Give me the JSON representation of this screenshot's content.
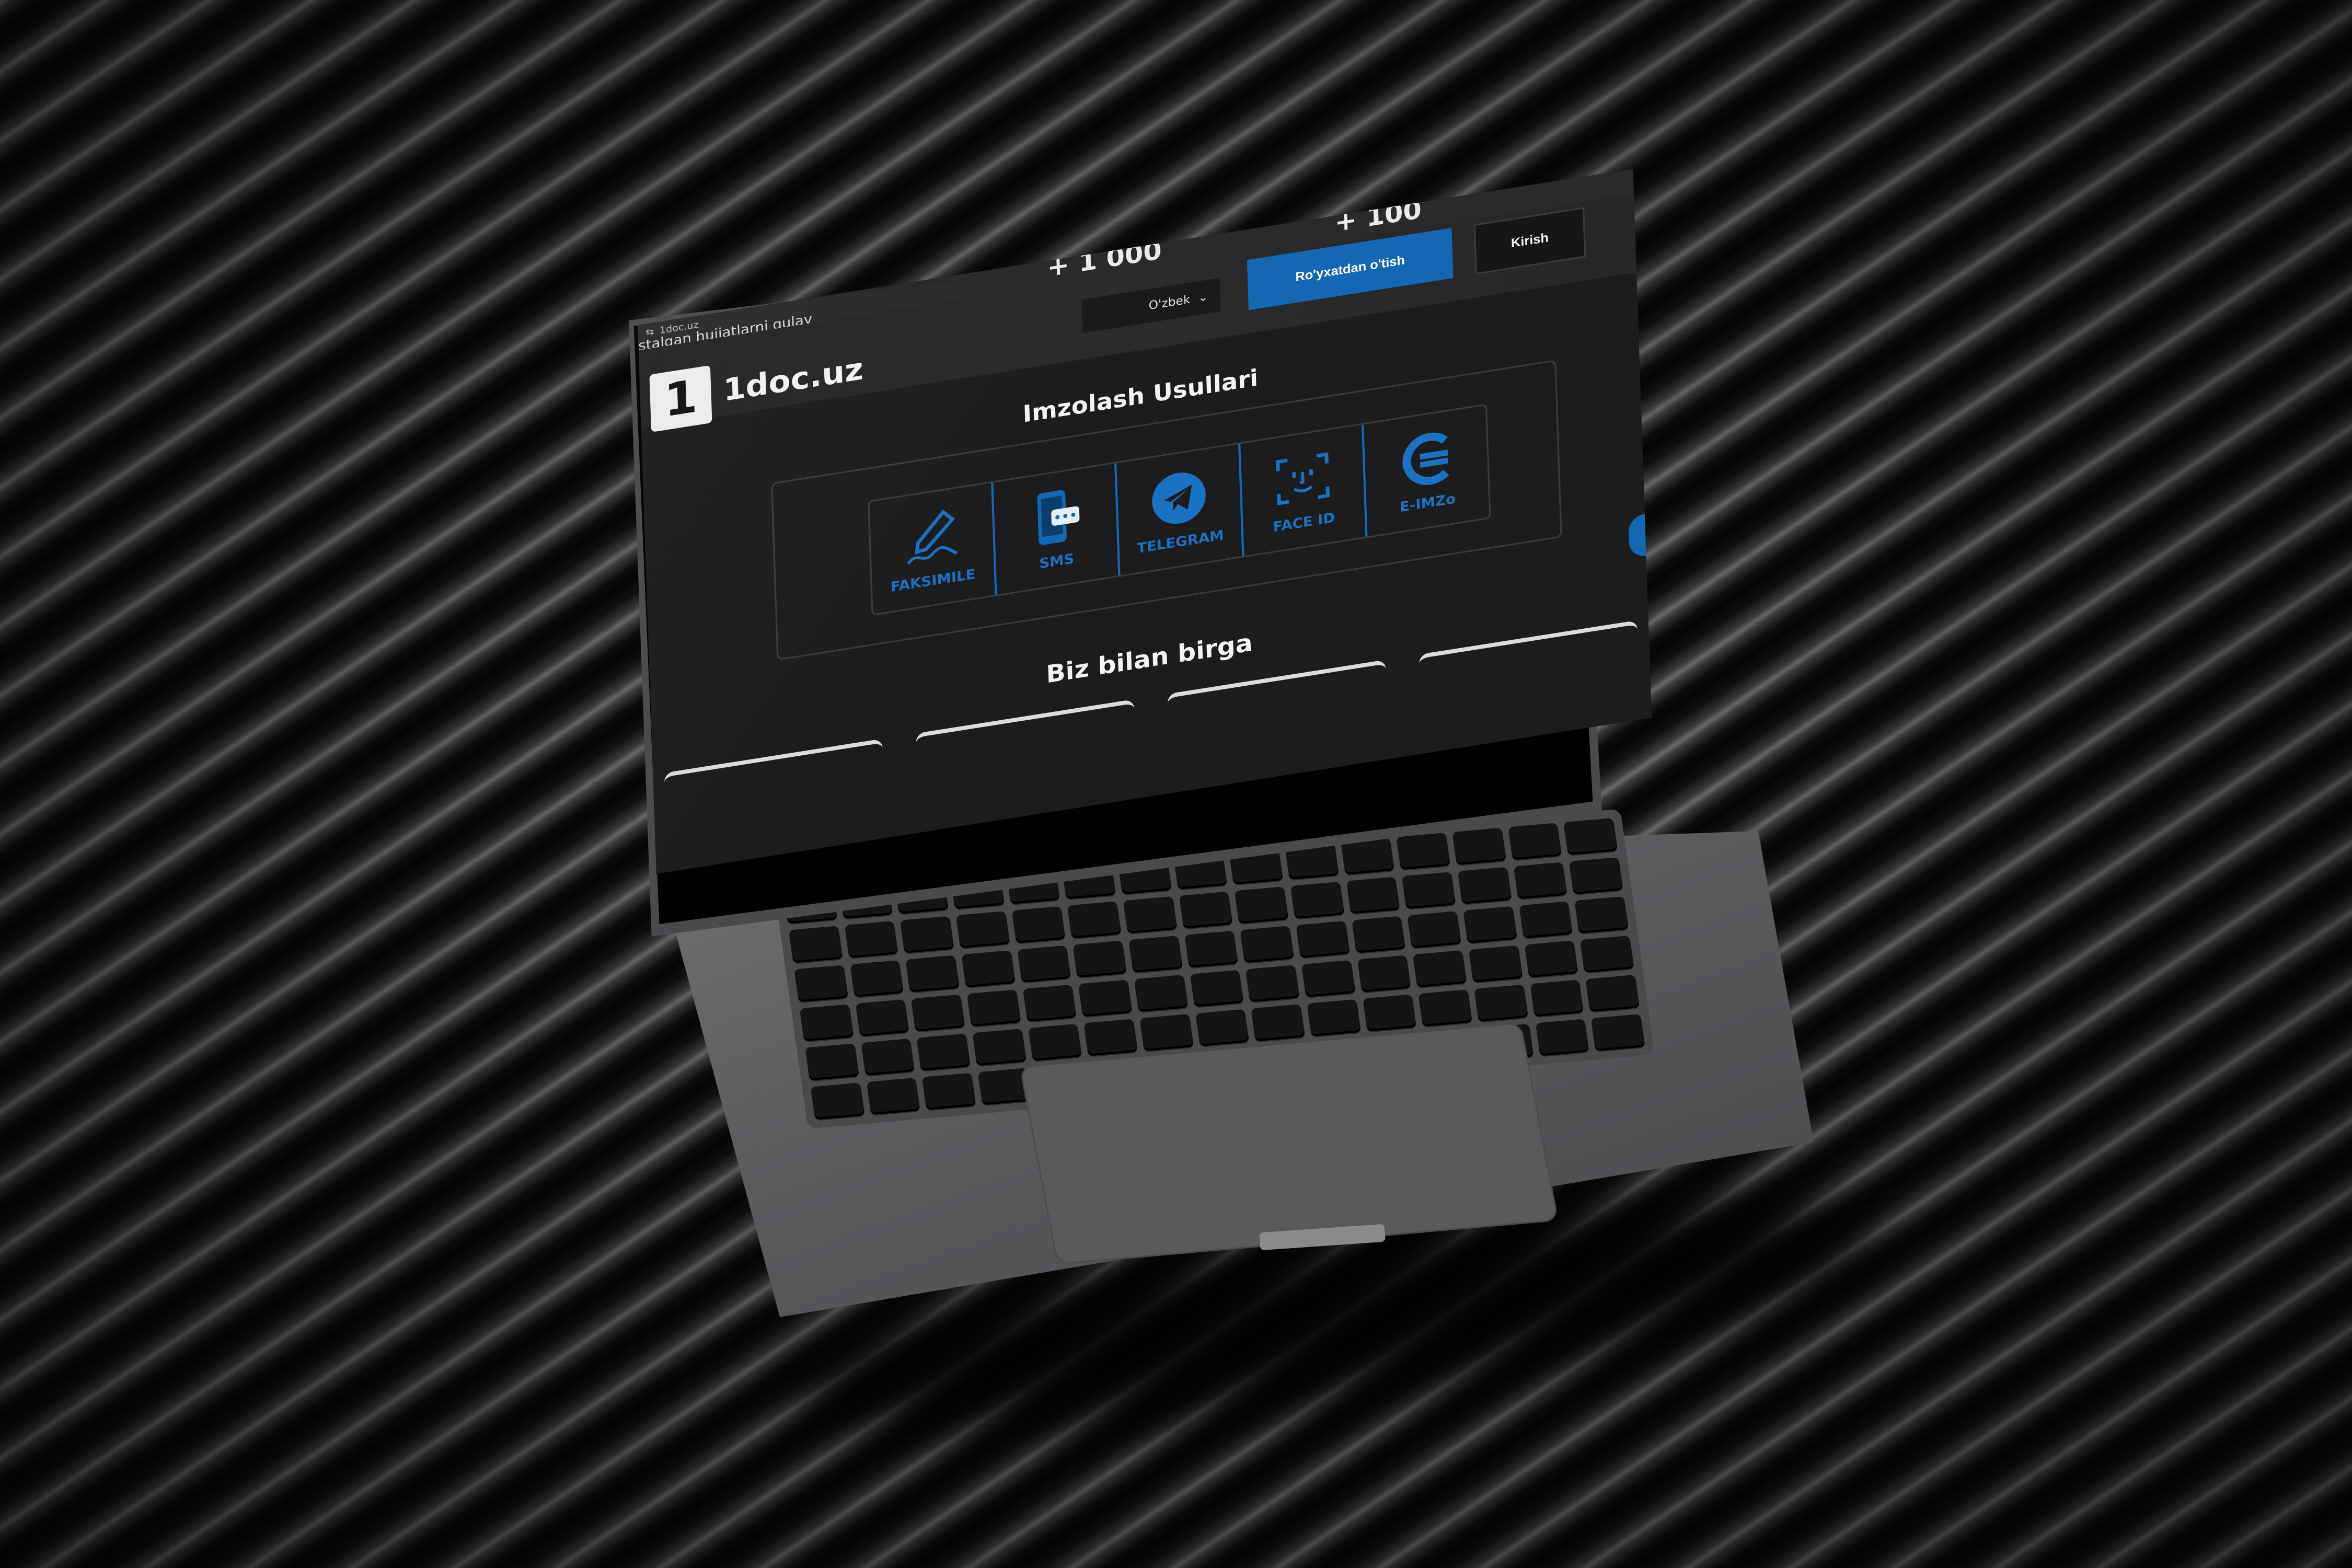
{
  "browser": {
    "url": "1doc.uz"
  },
  "ticker": {
    "text": "stalgan hujjatlarni qulay",
    "number_left": "+ 1 000",
    "number_right": "+ 100"
  },
  "header": {
    "logo_glyph": "1",
    "site_name": "1doc.uz",
    "language": "O'zbek",
    "register_label": "Ro'yxatdan o'tish",
    "login_label": "Kirish"
  },
  "methods": {
    "title": "Imzolash Usullari",
    "items": [
      {
        "label": "FAKSIMILE",
        "icon": "signature-pen-icon"
      },
      {
        "label": "SMS",
        "icon": "phone-sms-icon"
      },
      {
        "label": "TELEGRAM",
        "icon": "telegram-icon"
      },
      {
        "label": "FACE ID",
        "icon": "face-id-icon"
      },
      {
        "label": "E-IMZo",
        "icon": "e-imzo-icon"
      }
    ]
  },
  "partners": {
    "title": "Biz bilan birga"
  },
  "colors": {
    "accent": "#1467b3",
    "page_bg": "#1c1c1c",
    "header_bg": "#262626",
    "text": "#f4f4f4"
  }
}
